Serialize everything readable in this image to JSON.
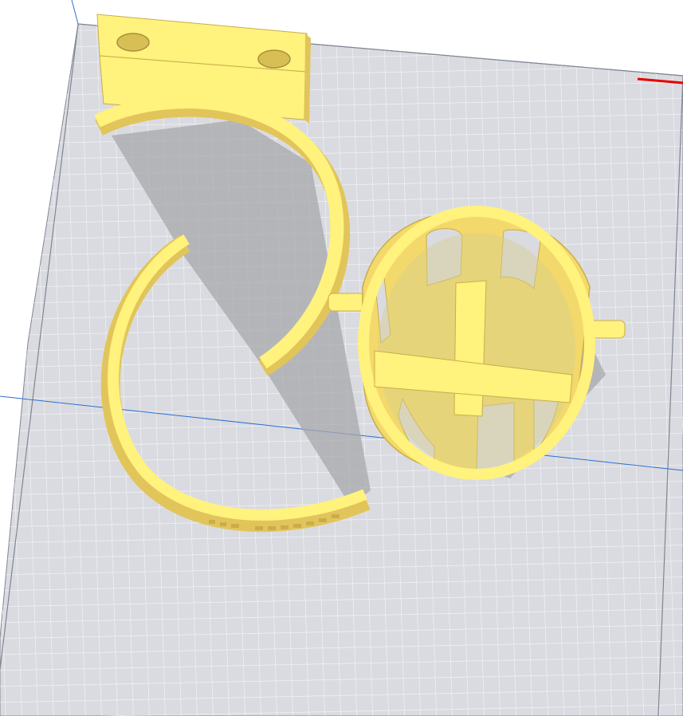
{
  "viewport": {
    "view": "3d-build-plate",
    "background_color": "#ffffff",
    "plate_color": "#dadbe0",
    "grid_color": "#f6f7fa",
    "grid_minor_color": "#eceef2",
    "plate_edge_color": "#7e8593",
    "axis_x_color": "#e60000",
    "axis_line_color": "#2b6fd3",
    "model_color": "#fff27d",
    "model_side_color": "#f3d96b",
    "model_shade_color": "#e2c55a",
    "model_edge_color": "#c9ad4a",
    "shadow_color": "#a7a8ab"
  },
  "objects": [
    {
      "name": "mounting-bracket-with-two-holes"
    },
    {
      "name": "open-ring-with-engraved-text"
    },
    {
      "name": "cylindrical-cage-with-side-pins"
    }
  ]
}
